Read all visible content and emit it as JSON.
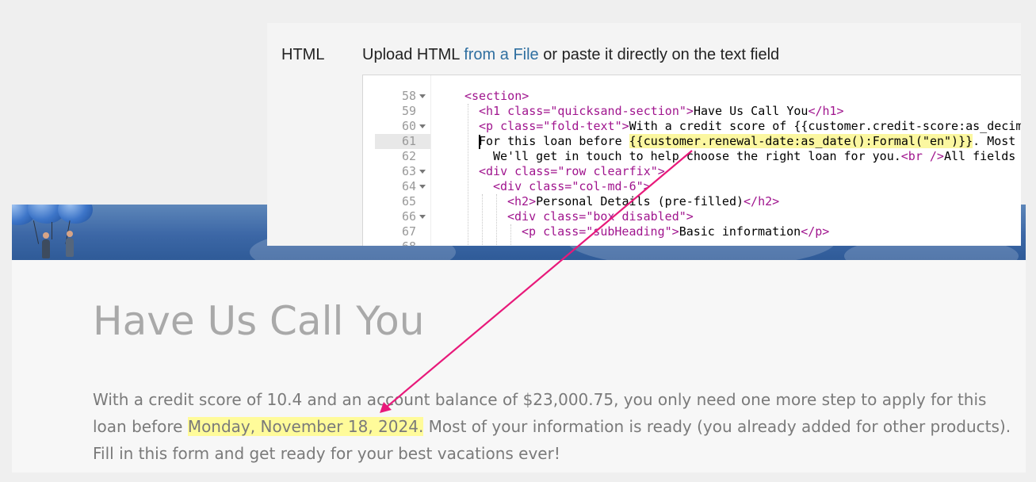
{
  "editor": {
    "html_label": "HTML",
    "upload_prefix": "Upload HTML ",
    "upload_link": "from a File",
    "upload_suffix": " or paste it directly on the text field",
    "lines": [
      {
        "num": "58",
        "fold": true
      },
      {
        "num": "59",
        "fold": false
      },
      {
        "num": "60",
        "fold": true
      },
      {
        "num": "61",
        "fold": false
      },
      {
        "num": "62",
        "fold": false
      },
      {
        "num": "63",
        "fold": true
      },
      {
        "num": "64",
        "fold": true
      },
      {
        "num": "65",
        "fold": false
      },
      {
        "num": "66",
        "fold": true
      },
      {
        "num": "67",
        "fold": false
      }
    ],
    "code": {
      "l58_tag": "<section>",
      "l59_open": "<h1 ",
      "l59_attr": "class=",
      "l59_val": "\"quicksand-section\"",
      "l59_close": ">",
      "l59_text": "Have Us Call You",
      "l59_end": "</h1>",
      "l60_open": "<p ",
      "l60_attr": "class=",
      "l60_val": "\"fold-text\"",
      "l60_close": ">",
      "l60_text": "With a credit score of {{customer.credit-score:as_decim",
      "l61_text_a": "For this loan before ",
      "l61_hl": "{{customer.renewal-date:as_date():Formal(\"en\")}}",
      "l61_text_b": ". Most",
      "l62_text": "We'll get in touch to help choose the right loan for you.",
      "l62_tag": "<br />",
      "l62_text_b": "All fields",
      "l63_open": "<div ",
      "l63_attr": "class=",
      "l63_val": "\"row clearfix\"",
      "l63_close": ">",
      "l64_open": "<div ",
      "l64_attr": "class=",
      "l64_val": "\"col-md-6\"",
      "l64_close": ">",
      "l65_open": "<h2>",
      "l65_text": "Personal Details (pre-filled)",
      "l65_end": "</h2>",
      "l66_open": "<div ",
      "l66_attr": "class=",
      "l66_val": "\"box disabled\"",
      "l66_close": ">",
      "l67_open": "<p ",
      "l67_attr": "class=",
      "l67_val": "\"subHeading\"",
      "l67_close": ">",
      "l67_text": "Basic information",
      "l67_end": "</p>"
    }
  },
  "preview": {
    "title": "Have Us Call You",
    "paragraph_a": "With a credit score of 10.4 and an account balance of $23,000.75, you only need one more step to apply for this loan before ",
    "highlight": "Monday, November 18, 2024.",
    "paragraph_b": " Most of your information is ready (you already added for other products). Fill in this form and get ready for your best vacations ever!"
  },
  "colors": {
    "arrow": "#e8197a",
    "highlight": "#fffb9a",
    "link": "#2f6fa0",
    "code_tag": "#a0158e"
  }
}
